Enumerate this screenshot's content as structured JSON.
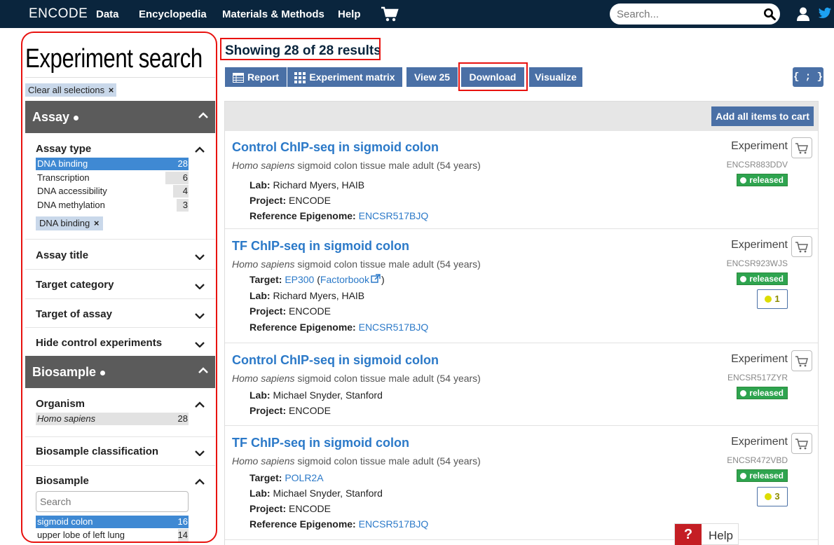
{
  "nav": {
    "brand": "ENCODE",
    "items": [
      "Data",
      "Encyclopedia",
      "Materials & Methods",
      "Help"
    ],
    "search_placeholder": "Search..."
  },
  "sidebar": {
    "title": "Experiment search",
    "clear_all": "Clear all selections",
    "assay_group": "Assay",
    "assay_type": {
      "title": "Assay type",
      "terms": [
        {
          "name": "DNA binding",
          "count": "28",
          "selected": true
        },
        {
          "name": "Transcription",
          "count": "6"
        },
        {
          "name": "DNA accessibility",
          "count": "4"
        },
        {
          "name": "DNA methylation",
          "count": "3"
        }
      ],
      "chip": "DNA binding"
    },
    "facets_collapsed": [
      "Assay title",
      "Target category",
      "Target of assay",
      "Hide control experiments"
    ],
    "biosample_group": "Biosample",
    "organism": {
      "title": "Organism",
      "term": "Homo sapiens",
      "count": "28"
    },
    "biosample_classification": "Biosample classification",
    "biosample": {
      "title": "Biosample",
      "search_placeholder": "Search",
      "terms": [
        {
          "name": "sigmoid colon",
          "count": "16",
          "selected": true
        },
        {
          "name": "upper lobe of left lung",
          "count": "14"
        }
      ]
    }
  },
  "main": {
    "results_count": "Showing 28 of 28 results",
    "buttons": {
      "report": "Report",
      "matrix": "Experiment matrix",
      "view25": "View 25",
      "download": "Download",
      "visualize": "Visualize",
      "json": "{ ; }"
    },
    "add_all": "Add all items to cart",
    "results": [
      {
        "title": "Control ChIP-seq in sigmoid colon",
        "species": "Homo sapiens",
        "desc": " sigmoid colon tissue male adult (54 years)",
        "type": "Experiment",
        "accession": "ENCSR883DDV",
        "status": "released",
        "lab": "Richard Myers, HAIB",
        "project": "ENCODE",
        "ref_epigenome": "ENCSR517BJQ"
      },
      {
        "title": "TF ChIP-seq in sigmoid colon",
        "species": "Homo sapiens",
        "desc": " sigmoid colon tissue male adult (54 years)",
        "type": "Experiment",
        "accession": "ENCSR923WJS",
        "status": "released",
        "target": "EP300",
        "factorbook": "Factorbook",
        "lab": "Richard Myers, HAIB",
        "project": "ENCODE",
        "ref_epigenome": "ENCSR517BJQ",
        "audit_count": "1"
      },
      {
        "title": "Control ChIP-seq in sigmoid colon",
        "species": "Homo sapiens",
        "desc": " sigmoid colon tissue male adult (54 years)",
        "type": "Experiment",
        "accession": "ENCSR517ZYR",
        "status": "released",
        "lab": "Michael Snyder, Stanford",
        "project": "ENCODE"
      },
      {
        "title": "TF ChIP-seq in sigmoid colon",
        "species": "Homo sapiens",
        "desc": " sigmoid colon tissue male adult (54 years)",
        "type": "Experiment",
        "accession": "ENCSR472VBD",
        "status": "released",
        "target": "POLR2A",
        "lab": "Michael Snyder, Stanford",
        "project": "ENCODE",
        "ref_epigenome": "ENCSR517BJQ",
        "audit_count": "3"
      }
    ],
    "labels": {
      "lab": "Lab:",
      "project": "Project:",
      "ref": "Reference Epigenome:",
      "target": "Target:"
    }
  },
  "help": {
    "icon": "?",
    "label": "Help"
  },
  "colors": {
    "nav_bg": "#0a253d",
    "button": "#4a70a6",
    "link": "#2b79c8",
    "released": "#2ea44f",
    "highlight": "#e8120f"
  }
}
